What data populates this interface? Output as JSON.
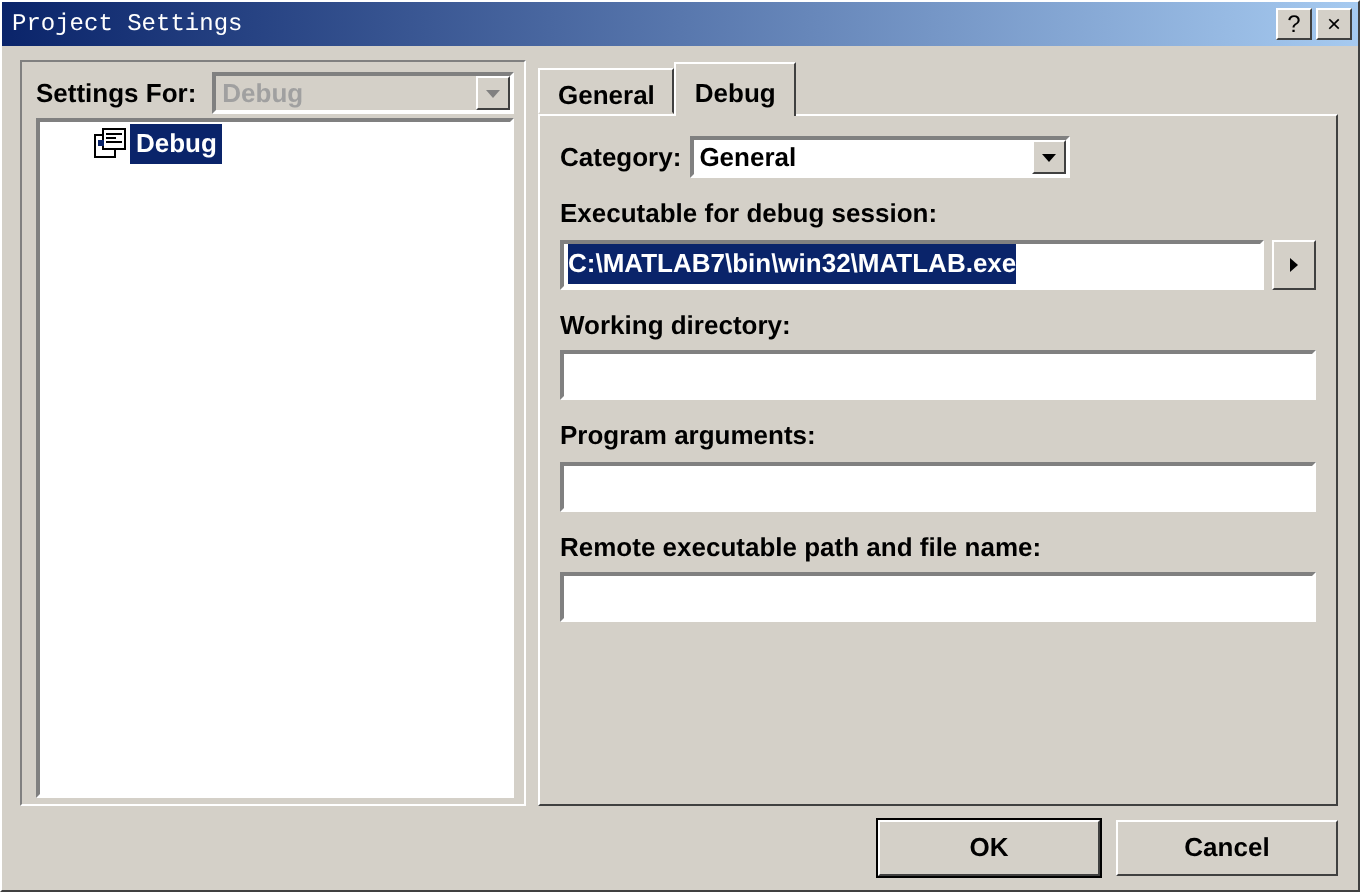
{
  "window": {
    "title": "Project Settings",
    "title_buttons": [
      "?",
      "×"
    ]
  },
  "settings_for": {
    "label": "Settings For:",
    "value": "Debug",
    "disabled": true
  },
  "tree": {
    "items": [
      {
        "label": "Debug",
        "selected": true
      }
    ]
  },
  "tabs": [
    {
      "label": "General",
      "selected": false
    },
    {
      "label": "Debug",
      "selected": true
    }
  ],
  "category": {
    "label": "Category:",
    "value": "General"
  },
  "fields": [
    {
      "label": "Executable for debug session:",
      "value": "C:\\MATLAB7\\bin\\win32\\MATLAB.exe",
      "value_selected": true,
      "has_browse": true
    },
    {
      "label": "Working directory:"
    },
    {
      "label": "Program arguments:"
    },
    {
      "label": "Remote executable path and file name:"
    }
  ],
  "buttons": [
    "OK",
    "Cancel"
  ]
}
